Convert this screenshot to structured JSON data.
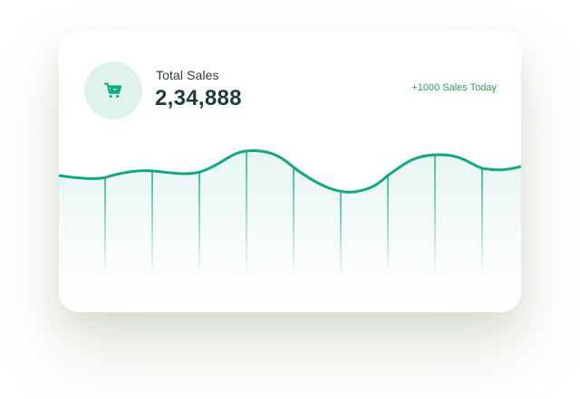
{
  "card": {
    "icon": "shopping-cart-icon",
    "title": "Total Sales",
    "value": "2,34,888",
    "badge": "+1000 Sales Today"
  },
  "colors": {
    "accent": "#13a883",
    "icon_bg": "#dff3ec",
    "badge_text": "#2fa05a",
    "value_text": "#1f3b3b"
  }
}
